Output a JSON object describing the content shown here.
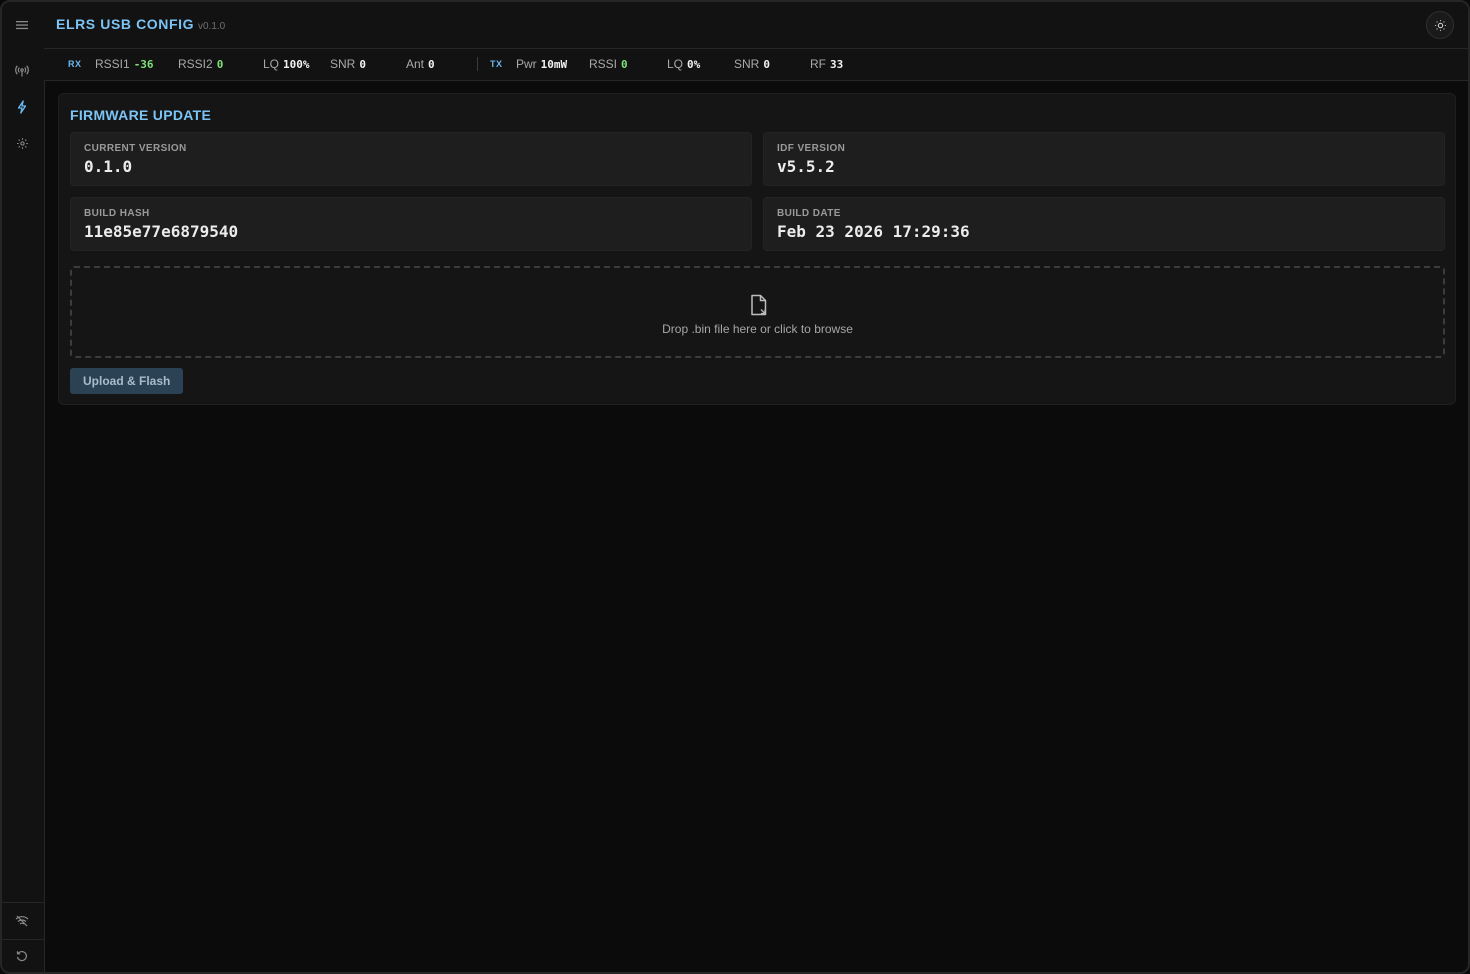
{
  "app": {
    "title": "ELRS USB CONFIG",
    "version": "v0.1.0"
  },
  "sidebar": {
    "items": [
      {
        "icon": "menu-icon"
      },
      {
        "icon": "antenna-icon"
      },
      {
        "icon": "lightning-icon",
        "active": true
      },
      {
        "icon": "gear-icon"
      }
    ],
    "bottom": [
      {
        "icon": "wifi-off-icon"
      },
      {
        "icon": "refresh-icon"
      }
    ]
  },
  "status": {
    "rx": {
      "tag": "RX",
      "rssi1_label": "RSSI1",
      "rssi1": "-36",
      "rssi2_label": "RSSI2",
      "rssi2": "0",
      "lq_label": "LQ",
      "lq": "100%",
      "snr_label": "SNR",
      "snr": "0",
      "ant_label": "Ant",
      "ant": "0"
    },
    "tx": {
      "tag": "TX",
      "pwr_label": "Pwr",
      "pwr": "10mW",
      "rssi_label": "RSSI",
      "rssi": "0",
      "lq_label": "LQ",
      "lq": "0%",
      "snr_label": "SNR",
      "snr": "0",
      "rf_label": "RF",
      "rf": "33"
    }
  },
  "firmware": {
    "title": "FIRMWARE UPDATE",
    "current_version": {
      "label": "CURRENT VERSION",
      "value": "0.1.0"
    },
    "idf_version": {
      "label": "IDF VERSION",
      "value": "v5.5.2"
    },
    "build_hash": {
      "label": "BUILD HASH",
      "value": "11e85e77e6879540"
    },
    "build_date": {
      "label": "BUILD DATE",
      "value": "Feb 23 2026 17:29:36"
    },
    "dropzone_hint": "Drop .bin file here or click to browse",
    "upload_label": "Upload & Flash"
  },
  "colors": {
    "accent": "#7cc4f5",
    "positive": "#7fe07a",
    "button_bg": "#2b4254"
  }
}
